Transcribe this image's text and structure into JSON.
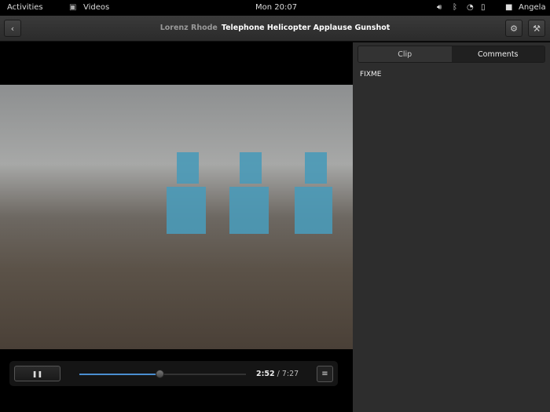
{
  "topbar": {
    "activities": "Activities",
    "app": "Videos",
    "clock": "Mon 20:07",
    "user": "Angela"
  },
  "header": {
    "artist": "Lorenz Rhode",
    "title": "Telephone Helicopter Applause Gunshot"
  },
  "sidebar": {
    "tabs": [
      {
        "label": "Clip"
      },
      {
        "label": "Comments",
        "active": true
      }
    ],
    "content": "FIXME"
  },
  "player": {
    "current": "2:52",
    "total": "/ 7:27",
    "progress": 0.48,
    "accent": "#4a8ed0"
  }
}
